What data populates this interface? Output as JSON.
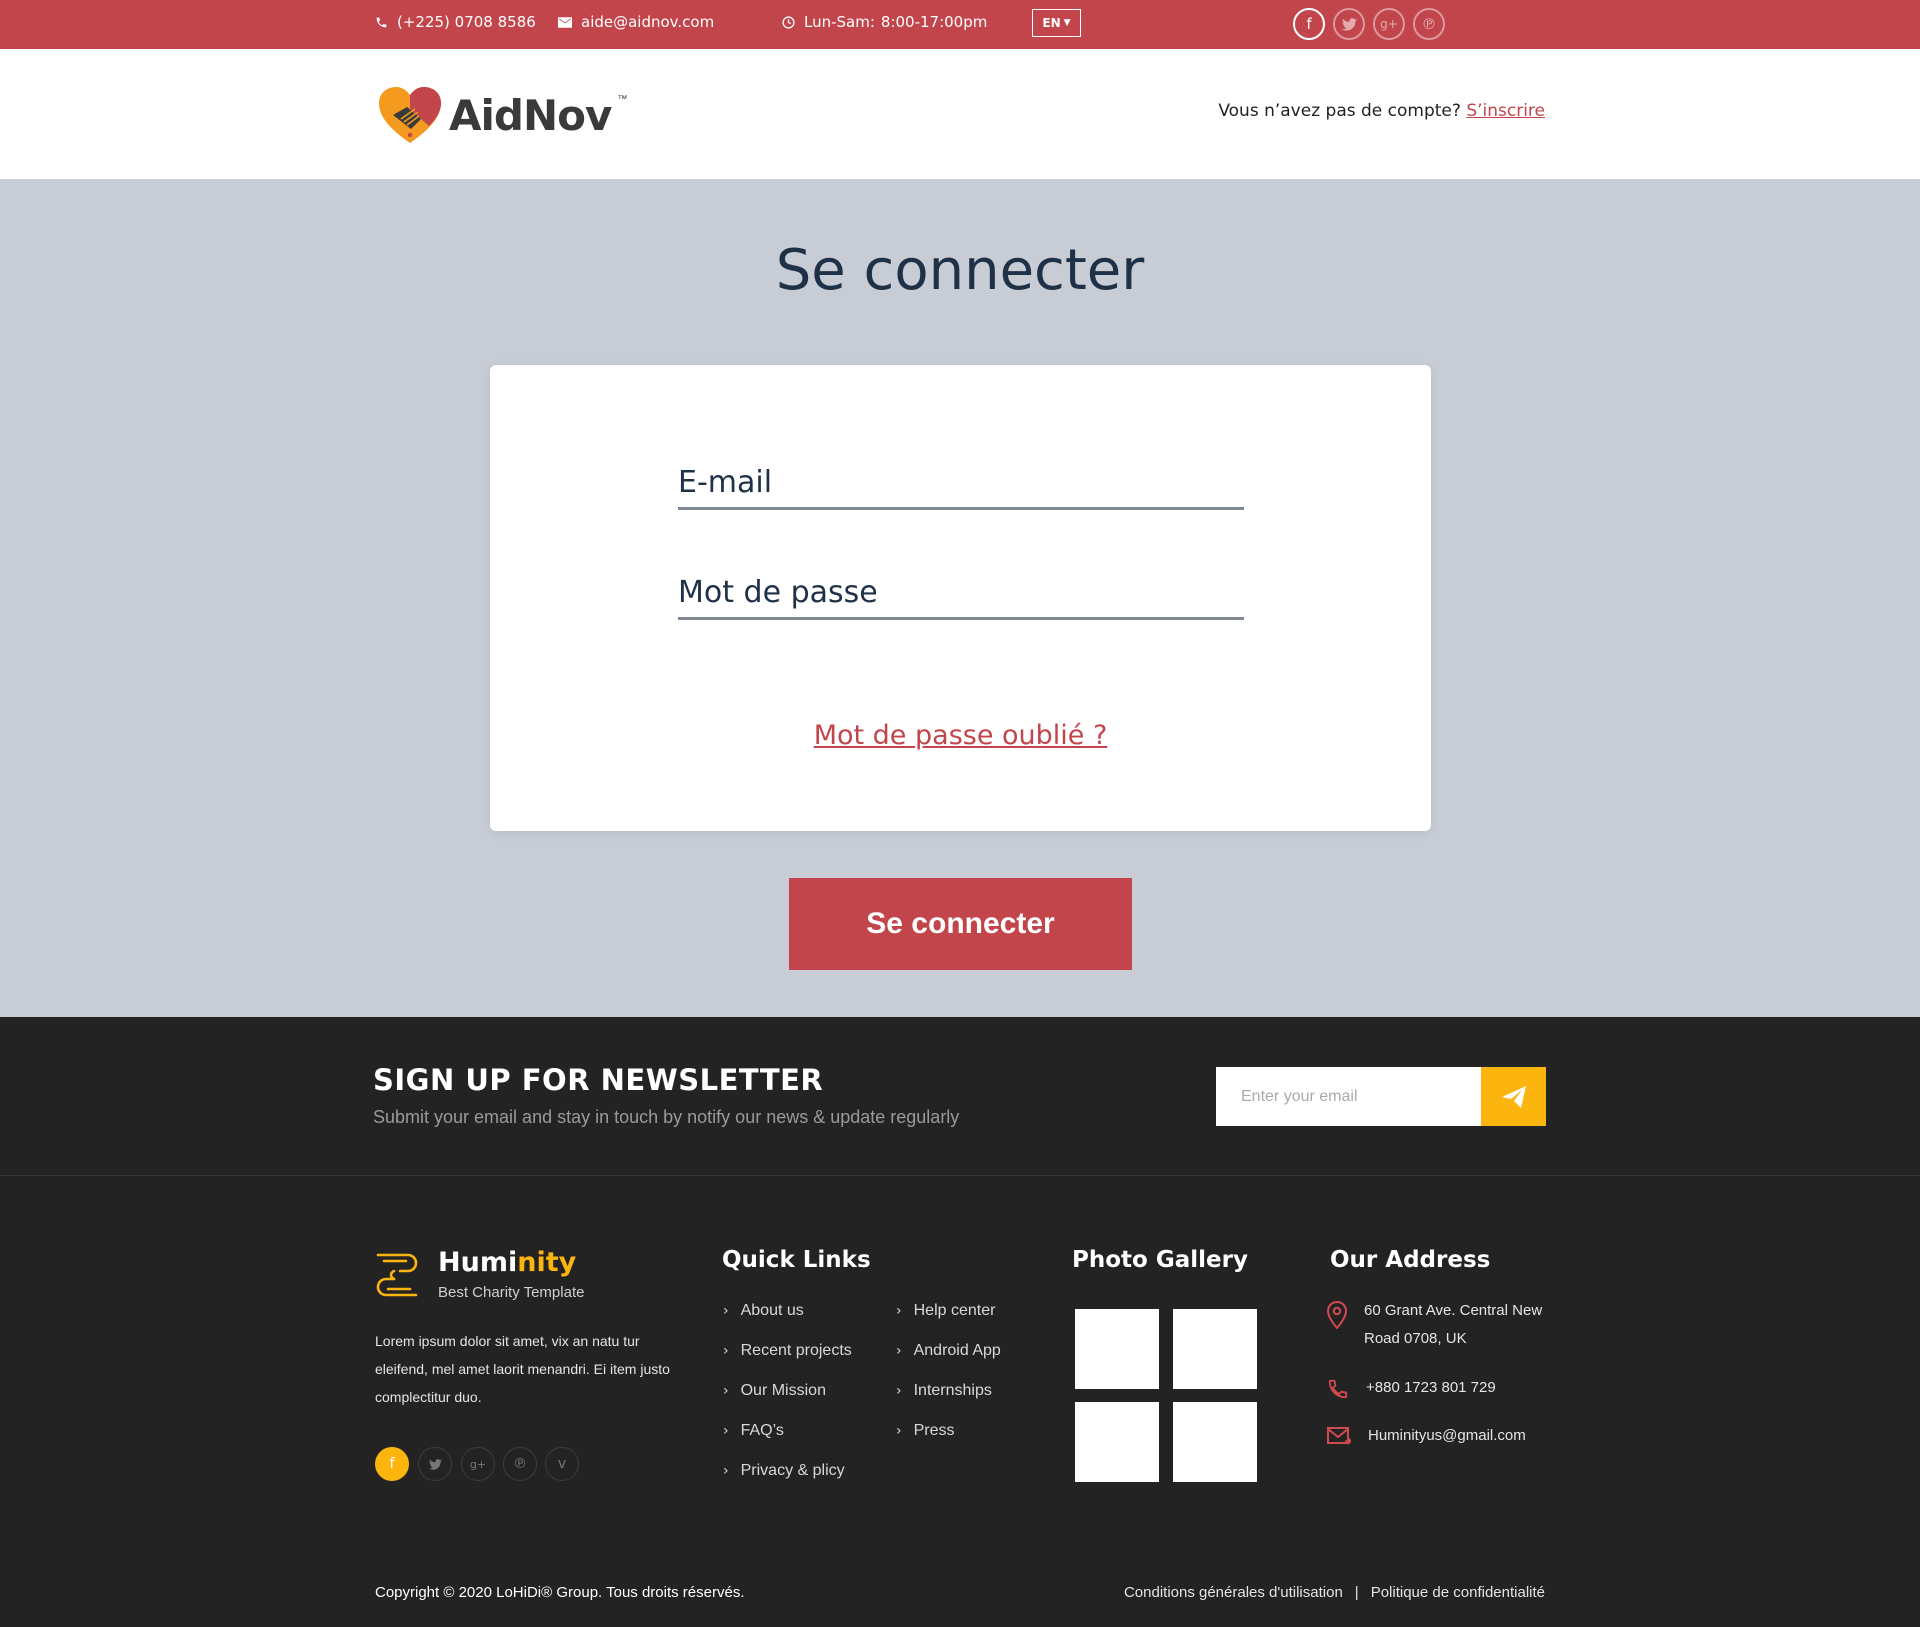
{
  "topbar": {
    "phone": "(+225) 0708 8586",
    "email": "aide@aidnov.com",
    "hours_label": "Lun-Sam:",
    "hours_value": "8:00-17:00pm",
    "language": "EN",
    "social_icons": [
      "facebook-icon",
      "twitter-icon",
      "google-plus-icon",
      "pinterest-icon"
    ]
  },
  "header": {
    "brand": "AidNov",
    "brand_tm": "™",
    "signup_prompt": "Vous n’avez pas de compte?",
    "signup_link": "S’inscrire"
  },
  "main": {
    "title": "Se connecter",
    "email_placeholder": "E-mail",
    "password_placeholder": "Mot de passe",
    "forgot_link": "Mot de passe oublié ?",
    "submit_label": "Se connecter"
  },
  "newsletter": {
    "title": "SIGN UP FOR NEWSLETTER",
    "subtitle": "Submit your email and stay in touch by notify our news & update regularly",
    "input_placeholder": "Enter your email"
  },
  "footer": {
    "brand_name_part1": "Humi",
    "brand_name_part2": "nity",
    "brand_tagline": "Best Charity Template",
    "description": "Lorem ipsum dolor sit amet, vix an natu tur eleifend, mel amet laorit menandri. Ei item justo complectitur duo.",
    "quick_links_title": "Quick Links",
    "quick_links_col1": [
      "About us",
      "Recent projects",
      "Our Mission",
      "FAQ’s",
      "Privacy & plicy"
    ],
    "quick_links_col2": [
      "Help center",
      "Android App",
      "Internships",
      "Press"
    ],
    "gallery_title": "Photo Gallery",
    "address_title": "Our Address",
    "address_line1": "60 Grant Ave. Central New",
    "address_line2": "Road 0708, UK",
    "phone": "+880 1723 801 729",
    "email": "Huminityus@gmail.com",
    "copyright": "Copyright © 2020 LoHiDi® Group. Tous droits réservés.",
    "terms": "Conditions générales d'utilisation",
    "separator": "|",
    "privacy": "Politique de confidentialité"
  },
  "colors": {
    "brand_red": "#c1454b",
    "accent_yellow": "#fcb40f",
    "page_bg": "#c7ccd5",
    "footer_bg": "#232323"
  }
}
